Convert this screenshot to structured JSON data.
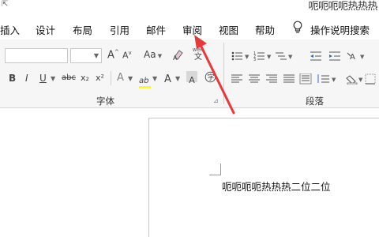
{
  "window": {
    "doc_title": "呃呃呃呃热热热"
  },
  "tabs": [
    {
      "label": "插入"
    },
    {
      "label": "设计"
    },
    {
      "label": "布局"
    },
    {
      "label": "引用"
    },
    {
      "label": "邮件"
    },
    {
      "label": "审阅"
    },
    {
      "label": "视图"
    },
    {
      "label": "帮助"
    }
  ],
  "tell_me": {
    "label": "操作说明搜索",
    "icon": "lightbulb-icon"
  },
  "font_group": {
    "label": "字体",
    "font_name": "",
    "font_size": "",
    "grow_label": "A",
    "shrink_label": "A",
    "case_label": "Aa",
    "bold": "B",
    "italic": "I",
    "underline": "U",
    "strike": "abc",
    "subscript": "x₂",
    "superscript": "x²",
    "effects": "A",
    "highlight": "ab",
    "font_color": "A",
    "char_shading": "A",
    "phonetic_top": "wén",
    "phonetic_bottom": "文"
  },
  "para_group": {
    "label": "段落"
  },
  "document": {
    "text": "呃呃呃呃热热热二位二位"
  },
  "colors": {
    "accent_arrow": "#e8393a",
    "highlight_yellow": "#ffff00",
    "font_red": "#d62b2b"
  }
}
